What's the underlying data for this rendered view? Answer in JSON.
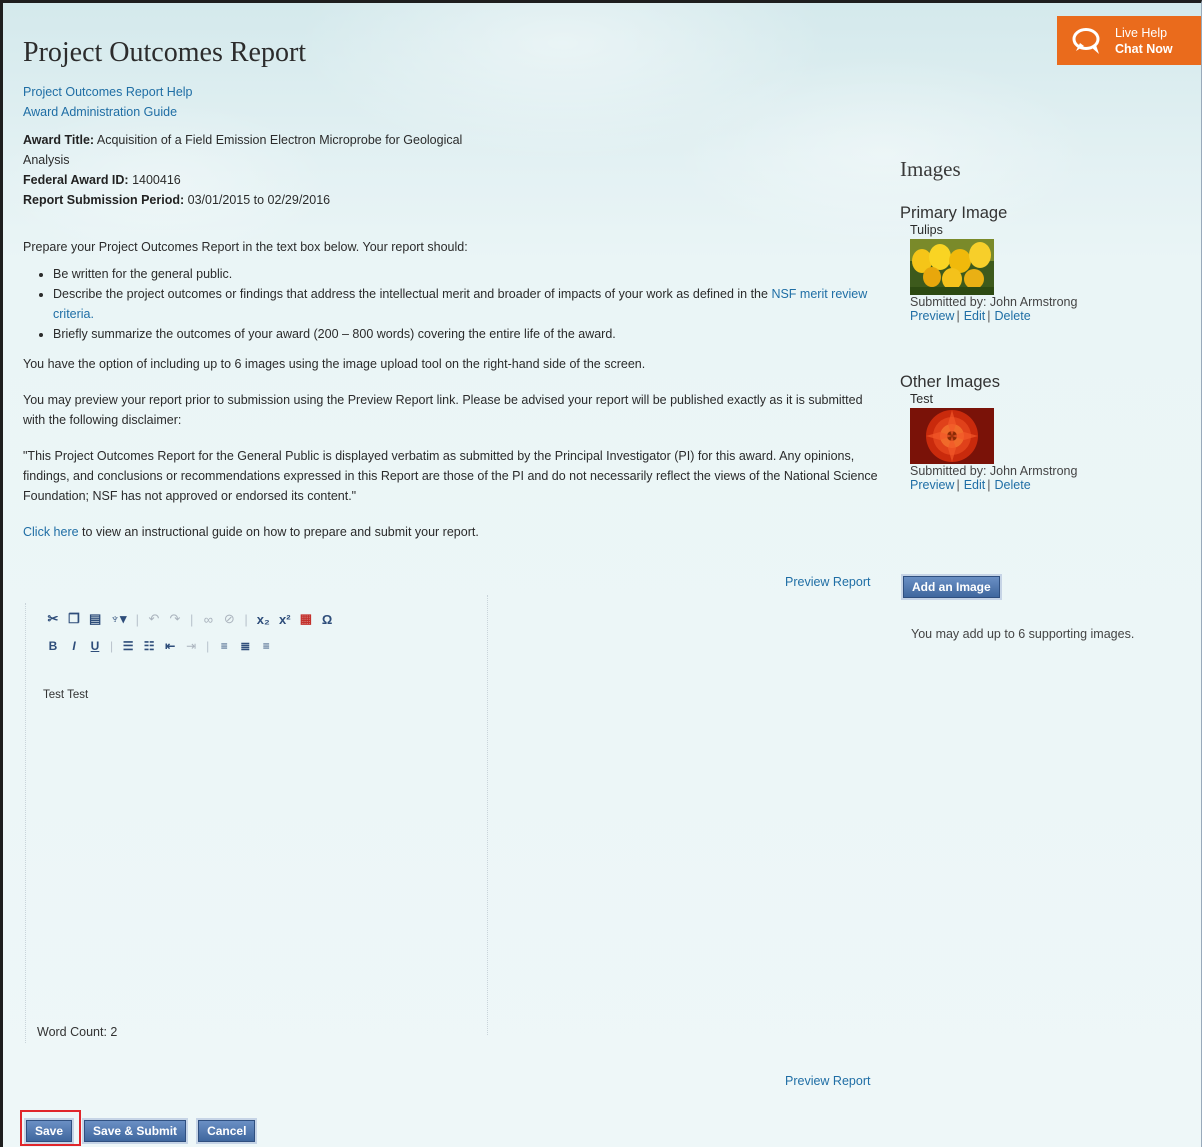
{
  "header": {
    "title": "Project Outcomes Report",
    "links": [
      "Project Outcomes Report Help",
      "Award Administration Guide"
    ]
  },
  "live_help": {
    "line1": "Live Help",
    "line2": "Chat Now",
    "brand_color": "#ea6b1c",
    "icon": "chat-bubble-icon"
  },
  "award": {
    "title_label": "Award Title:",
    "title_value": "Acquisition of a Field Emission Electron Microprobe for Geological Analysis",
    "id_label": "Federal Award ID:",
    "id_value": "1400416",
    "period_label": "Report Submission Period:",
    "period_value": "03/01/2015 to 02/29/2016"
  },
  "instructions": {
    "intro": "Prepare your Project Outcomes Report in the text box below.  Your report should:",
    "bullet1": "Be written for the general public.",
    "bullet2_before": "Describe the project outcomes or findings that address the intellectual merit and broader of impacts of your work as defined in the ",
    "bullet2_link": "NSF merit review criteria.",
    "bullet3": "Briefly summarize the outcomes of your award (200 – 800 words) covering the entire life of the award.",
    "images_note": "You have the option of including up to 6 images using the image upload tool on the right-hand side of the screen.",
    "preview_note": "You may preview your report prior to submission using the Preview Report link.  Please be advised your report will be published exactly as it is submitted with the following disclaimer:",
    "disclaimer": "\"This Project Outcomes Report for the General Public is displayed verbatim as submitted by the Principal Investigator (PI) for this award. Any opinions, findings, and conclusions or recommendations expressed in this Report are those of the PI and do not necessarily reflect the views of the National Science Foundation; NSF has not approved or endorsed its content.\"",
    "guide_link": "Click here",
    "guide_text": " to view an instructional guide on how to prepare and submit your report."
  },
  "preview_report_label": "Preview Report",
  "editor": {
    "content": "Test Test",
    "word_count": "Word Count: 2"
  },
  "images_panel": {
    "heading": "Images",
    "primary_heading": "Primary Image",
    "primary_name": "Tulips",
    "primary_submitted": "Submitted by: John Armstrong",
    "other_heading": "Other Images",
    "other_name": "Test",
    "other_submitted": "Submitted by: John Armstrong",
    "action_preview": "Preview",
    "action_edit": "Edit",
    "action_delete": "Delete",
    "add_button": "Add an Image",
    "add_note": "You may add up to 6 supporting images."
  },
  "footer": {
    "save": "Save",
    "save_submit": "Save & Submit",
    "cancel": "Cancel"
  }
}
